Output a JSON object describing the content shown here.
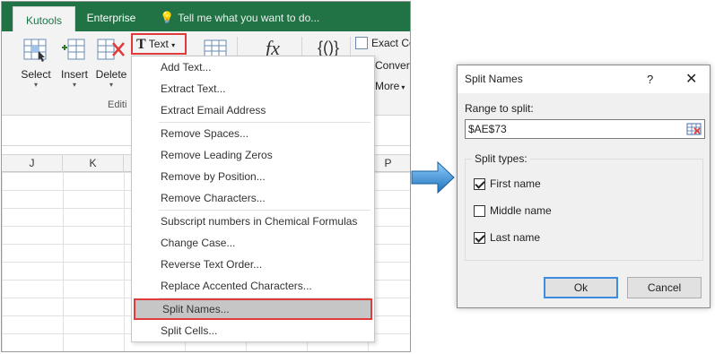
{
  "excel": {
    "tabs": [
      {
        "label": "Kutools",
        "active": true
      },
      {
        "label": "Enterprise",
        "active": false
      }
    ],
    "tell_me": "Tell me what you want to do...",
    "ribbon": {
      "select_label": "Select",
      "insert_label": "Insert",
      "delete_label": "Delete",
      "text_label": "Text",
      "group_label": "Editi",
      "fx_label": "fx",
      "braces_label": "{()}",
      "exact_label": "Exact Co",
      "convert_label": "Convert",
      "more_label": "More"
    },
    "columns": [
      "J",
      "K",
      "P"
    ],
    "menu": {
      "items": [
        "Add Text...",
        "Extract Text...",
        "Extract Email Address",
        "Remove Spaces...",
        "Remove Leading Zeros",
        "Remove by Position...",
        "Remove Characters...",
        "Subscript numbers in Chemical Formulas",
        "Change Case...",
        "Reverse Text Order...",
        "Replace Accented Characters...",
        "Split Names...",
        "Split Cells..."
      ],
      "highlighted": "Split Names..."
    }
  },
  "dialog": {
    "title": "Split Names",
    "help": "?",
    "close": "✕",
    "range_label": "Range to split:",
    "range_value": "$AE$73",
    "split_types_label": "Split types:",
    "options": [
      {
        "label": "First name",
        "checked": true
      },
      {
        "label": "Middle name",
        "checked": false
      },
      {
        "label": "Last name",
        "checked": true
      }
    ],
    "ok_label": "Ok",
    "cancel_label": "Cancel"
  },
  "colors": {
    "excel_green": "#217346",
    "highlight_red": "#e03b3b",
    "arrow_blue": "#2e8fd8",
    "default_button_blue": "#3c8ce0"
  },
  "icons": [
    "lightbulb-icon",
    "select-icon",
    "insert-icon",
    "delete-icon",
    "text-icon",
    "formula-icon",
    "range-picker-icon",
    "arrow-right-icon"
  ]
}
